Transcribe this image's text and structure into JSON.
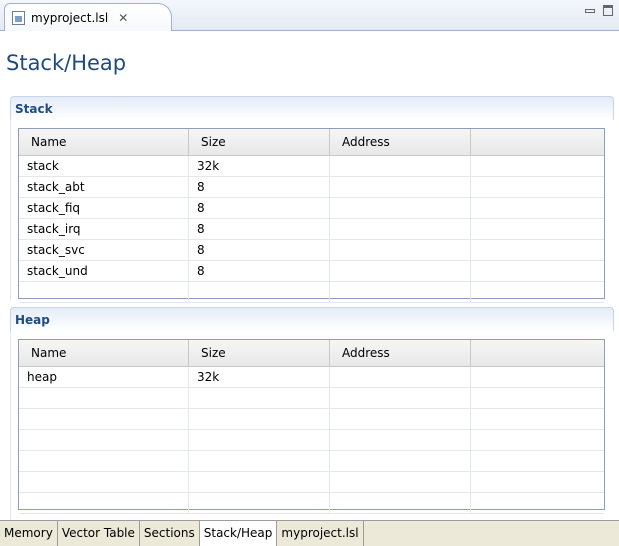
{
  "editor_tab": {
    "title": "myproject.lsl",
    "close_glyph": "✕"
  },
  "page_title": "Stack/Heap",
  "stack_section": {
    "title": "Stack",
    "columns": [
      "Name",
      "Size",
      "Address",
      ""
    ],
    "rows": [
      {
        "name": "stack",
        "size": "32k",
        "address": ""
      },
      {
        "name": "stack_abt",
        "size": "8",
        "address": ""
      },
      {
        "name": "stack_fiq",
        "size": "8",
        "address": ""
      },
      {
        "name": "stack_irq",
        "size": "8",
        "address": ""
      },
      {
        "name": "stack_svc",
        "size": "8",
        "address": ""
      },
      {
        "name": "stack_und",
        "size": "8",
        "address": ""
      }
    ]
  },
  "heap_section": {
    "title": "Heap",
    "columns": [
      "Name",
      "Size",
      "Address",
      ""
    ],
    "rows": [
      {
        "name": "heap",
        "size": "32k",
        "address": ""
      }
    ]
  },
  "page_tabs": [
    {
      "label": "Memory",
      "active": false
    },
    {
      "label": "Vector Table",
      "active": false
    },
    {
      "label": "Sections",
      "active": false
    },
    {
      "label": "Stack/Heap",
      "active": true
    },
    {
      "label": "myproject.lsl",
      "active": false
    }
  ]
}
